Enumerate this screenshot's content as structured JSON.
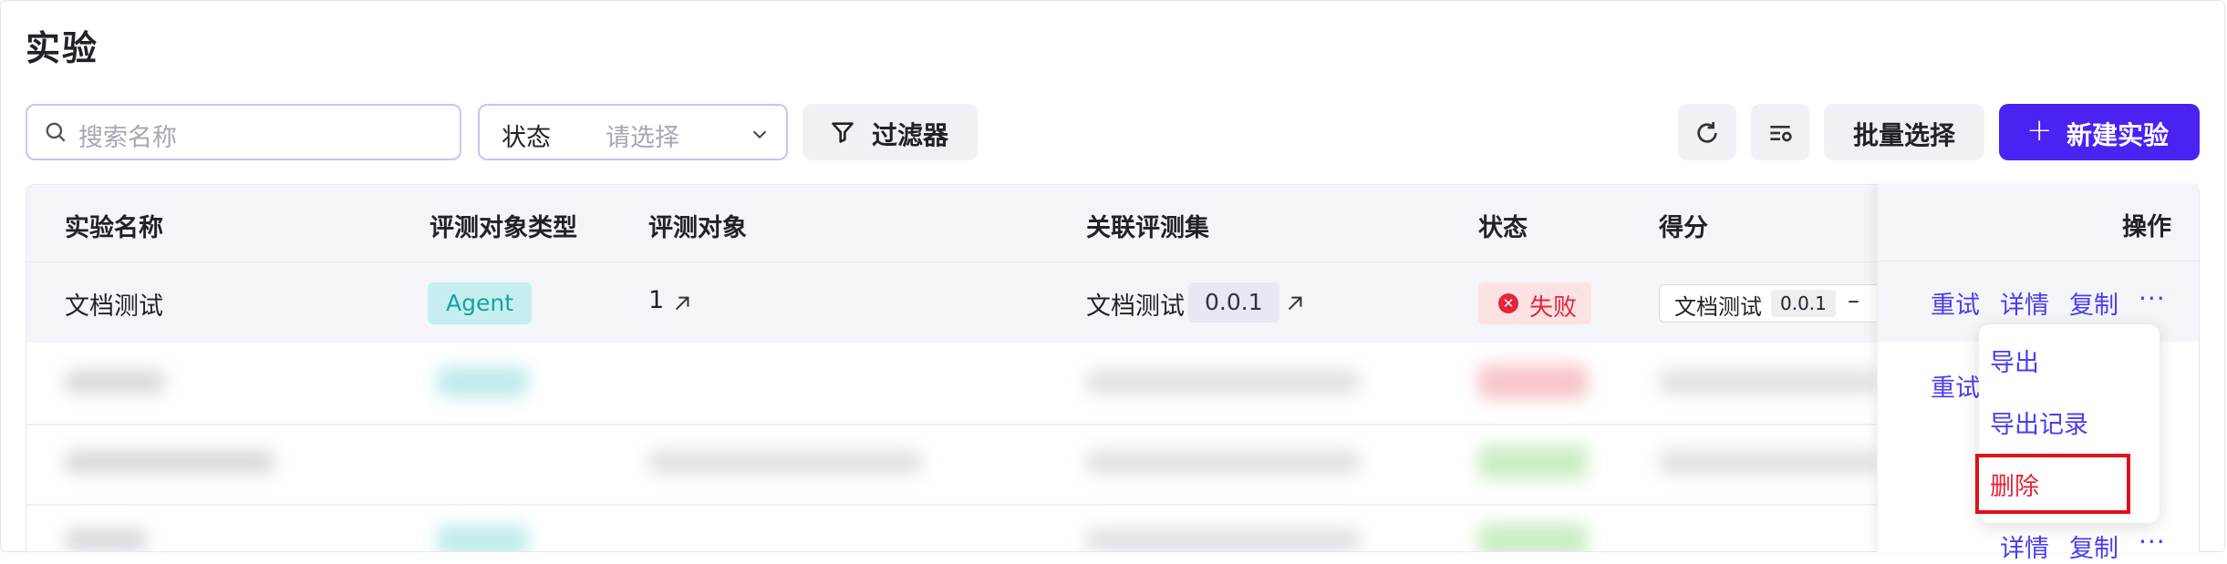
{
  "page": {
    "title": "实验"
  },
  "toolbar": {
    "search_placeholder": "搜索名称",
    "status_label": "状态",
    "status_placeholder": "请选择",
    "filter_label": "过滤器",
    "batch_label": "批量选择",
    "new_label": "新建实验",
    "accent": "#4a22f2"
  },
  "table": {
    "headers": {
      "name": "实验名称",
      "object_type": "评测对象类型",
      "object": "评测对象",
      "dataset": "关联评测集",
      "status": "状态",
      "score": "得分",
      "ops": "操作"
    },
    "row1": {
      "name": "文档测试",
      "object_type": "Agent",
      "object": "1",
      "dataset_name": "文档测试",
      "dataset_version": "0.0.1",
      "status": "失败",
      "score_name": "文档测试",
      "score_version": "0.0.1",
      "score_value": "–"
    },
    "row2": {
      "action_retry": "重试"
    },
    "row4": {
      "action_detail": "详情",
      "action_copy": "复制"
    },
    "actions": {
      "retry": "重试",
      "detail": "详情",
      "copy": "复制",
      "more": "···"
    }
  },
  "menu": {
    "items": [
      "导出",
      "导出记录",
      "删除"
    ],
    "danger_color": "#e5243a"
  }
}
